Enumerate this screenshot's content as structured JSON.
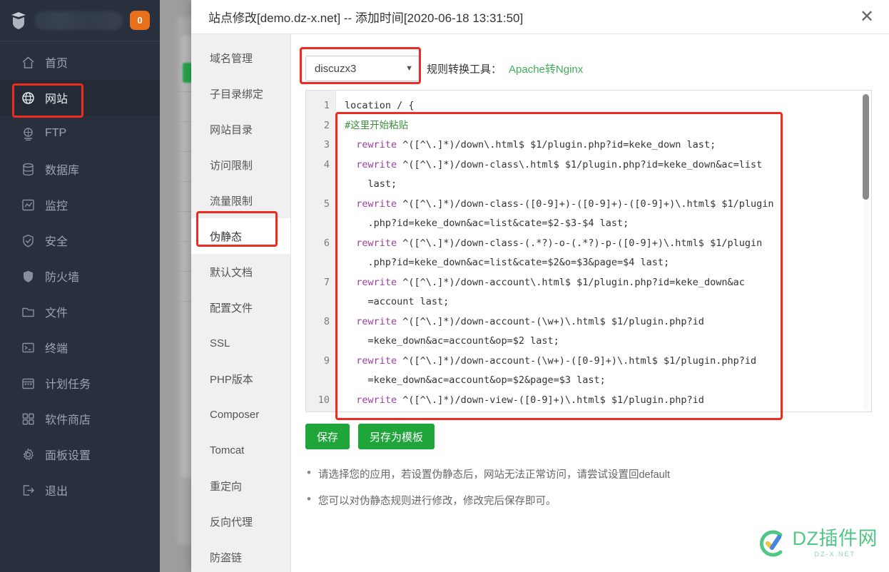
{
  "sidebar": {
    "user": {
      "badge": "0"
    },
    "items": [
      {
        "label": "首页",
        "icon": "home-icon",
        "active": false
      },
      {
        "label": "网站",
        "icon": "globe-icon",
        "active": true
      },
      {
        "label": "FTP",
        "icon": "ftp-icon",
        "active": false
      },
      {
        "label": "数据库",
        "icon": "database-icon",
        "active": false
      },
      {
        "label": "监控",
        "icon": "monitor-icon",
        "active": false
      },
      {
        "label": "安全",
        "icon": "shield-check-icon",
        "active": false
      },
      {
        "label": "防火墙",
        "icon": "firewall-shield-icon",
        "active": false
      },
      {
        "label": "文件",
        "icon": "folder-icon",
        "active": false
      },
      {
        "label": "终端",
        "icon": "terminal-icon",
        "active": false
      },
      {
        "label": "计划任务",
        "icon": "calendar-icon",
        "active": false
      },
      {
        "label": "软件商店",
        "icon": "grid-apps-icon",
        "active": false
      },
      {
        "label": "面板设置",
        "icon": "gear-icon",
        "active": false
      },
      {
        "label": "退出",
        "icon": "logout-icon",
        "active": false
      }
    ]
  },
  "modal": {
    "title": "站点修改[demo.dz-x.net] -- 添加时间[2020-06-18 13:31:50]",
    "close_label": "✕",
    "nav": [
      {
        "label": "域名管理",
        "active": false
      },
      {
        "label": "子目录绑定",
        "active": false
      },
      {
        "label": "网站目录",
        "active": false
      },
      {
        "label": "访问限制",
        "active": false
      },
      {
        "label": "流量限制",
        "active": false
      },
      {
        "label": "伪静态",
        "active": true
      },
      {
        "label": "默认文档",
        "active": false
      },
      {
        "label": "配置文件",
        "active": false
      },
      {
        "label": "SSL",
        "active": false
      },
      {
        "label": "PHP版本",
        "active": false
      },
      {
        "label": "Composer",
        "active": false
      },
      {
        "label": "Tomcat",
        "active": false
      },
      {
        "label": "重定向",
        "active": false
      },
      {
        "label": "反向代理",
        "active": false
      },
      {
        "label": "防盗链",
        "active": false
      }
    ],
    "toolbar": {
      "select_value": "discuzx3",
      "select_caret": "▼",
      "tool_label": "规则转换工具：",
      "tool_link": "Apache转Nginx"
    },
    "editor": {
      "line_numbers": [
        "1",
        "2",
        "3",
        "4",
        "",
        "5",
        "",
        "6",
        "",
        "7",
        "",
        "8",
        "",
        "9",
        "",
        "10"
      ],
      "lines": [
        {
          "indent": 0,
          "type": "code",
          "text": "location / {"
        },
        {
          "indent": 0,
          "type": "comment",
          "text": "#这里开始粘贴"
        },
        {
          "indent": 1,
          "type": "rewrite",
          "keyword": "rewrite",
          "rest": " ^([^\\.]*)/down\\.html$ $1/plugin.php?id=keke_down last;"
        },
        {
          "indent": 1,
          "type": "rewrite",
          "keyword": "rewrite",
          "rest": " ^([^\\.]*)/down-class\\.html$ $1/plugin.php?id=keke_down&ac=list"
        },
        {
          "indent": 2,
          "type": "code",
          "text": "last;"
        },
        {
          "indent": 1,
          "type": "rewrite",
          "keyword": "rewrite",
          "rest": " ^([^\\.]*)/down-class-([0-9]+)-([0-9]+)-([0-9]+)\\.html$ $1/plugin"
        },
        {
          "indent": 2,
          "type": "code",
          "text": ".php?id=keke_down&ac=list&cate=$2-$3-$4 last;"
        },
        {
          "indent": 1,
          "type": "rewrite",
          "keyword": "rewrite",
          "rest": " ^([^\\.]*)/down-class-(.*?)-o-(.*?)-p-([0-9]+)\\.html$ $1/plugin"
        },
        {
          "indent": 2,
          "type": "code",
          "text": ".php?id=keke_down&ac=list&cate=$2&o=$3&page=$4 last;"
        },
        {
          "indent": 1,
          "type": "rewrite",
          "keyword": "rewrite",
          "rest": " ^([^\\.]*)/down-account\\.html$ $1/plugin.php?id=keke_down&ac"
        },
        {
          "indent": 2,
          "type": "code",
          "text": "=account last;"
        },
        {
          "indent": 1,
          "type": "rewrite",
          "keyword": "rewrite",
          "rest": " ^([^\\.]*)/down-account-(\\w+)\\.html$ $1/plugin.php?id"
        },
        {
          "indent": 2,
          "type": "code",
          "text": "=keke_down&ac=account&op=$2 last;"
        },
        {
          "indent": 1,
          "type": "rewrite",
          "keyword": "rewrite",
          "rest": " ^([^\\.]*)/down-account-(\\w+)-([0-9]+)\\.html$ $1/plugin.php?id"
        },
        {
          "indent": 2,
          "type": "code",
          "text": "=keke_down&ac=account&op=$2&page=$3 last;"
        },
        {
          "indent": 1,
          "type": "rewrite",
          "keyword": "rewrite",
          "rest": " ^([^\\.]*)/down-view-([0-9]+)\\.html$ $1/plugin.php?id"
        }
      ]
    },
    "buttons": {
      "save": "保存",
      "save_as_template": "另存为模板"
    },
    "notes": [
      "请选择您的应用，若设置伪静态后，网站无法正常访问，请尝试设置回default",
      "您可以对伪静态规则进行修改，修改完后保存即可。"
    ]
  },
  "watermark": {
    "main": "DZ插件网",
    "sub": "DZ-X.NET"
  },
  "colors": {
    "sidebar_bg": "#28303d",
    "accent_green": "#20a53a",
    "link_green": "#3fae5a",
    "badge_orange": "#e8701a",
    "annotation_red": "#ee2b22"
  }
}
